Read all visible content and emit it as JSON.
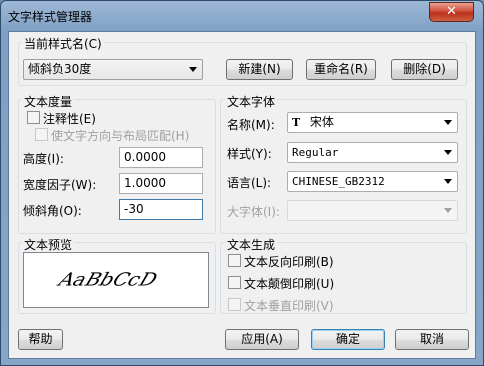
{
  "window": {
    "title": "文字样式管理器",
    "close_symbol": "✕"
  },
  "current_style": {
    "label": "当前样式名(C)",
    "value": "倾斜负30度"
  },
  "buttons": {
    "new": "新建(N)",
    "rename": "重命名(R)",
    "delete": "删除(D)",
    "help": "帮助",
    "apply": "应用(A)",
    "ok": "确定",
    "cancel": "取消"
  },
  "metrics": {
    "title": "文本度量",
    "annotative": "注释性(E)",
    "match_orientation": "使文字方向与布局匹配(H)",
    "height_label": "高度(I):",
    "height_value": "0.0000",
    "width_label": "宽度因子(W):",
    "width_value": "1.0000",
    "oblique_label": "倾斜角(O):",
    "oblique_value": "-30"
  },
  "font": {
    "title": "文本字体",
    "name_label": "名称(M):",
    "name_value": "宋体",
    "name_icon": "truetype-icon",
    "style_label": "样式(Y):",
    "style_value": "Regular",
    "lang_label": "语言(L):",
    "lang_value": "CHINESE_GB2312",
    "bigfont_label": "大字体(I):",
    "bigfont_value": ""
  },
  "preview": {
    "title": "文本预览",
    "sample": "AaBbCcD"
  },
  "generation": {
    "title": "文本生成",
    "backwards": "文本反向印刷(B)",
    "upside_down": "文本颠倒印刷(U)",
    "vertical": "文本垂直印刷(V)"
  }
}
